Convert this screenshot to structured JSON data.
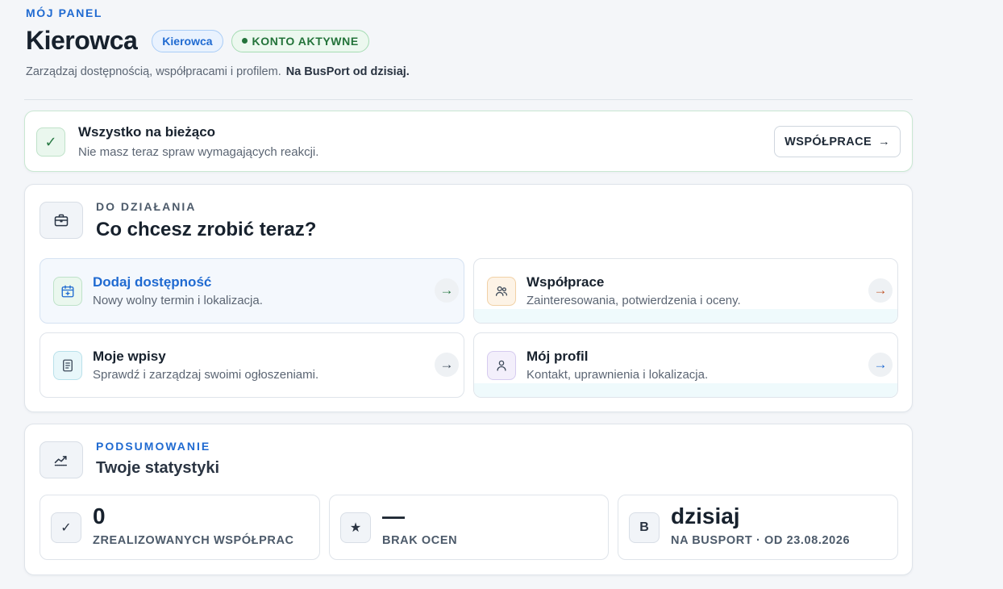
{
  "header": {
    "eyebrow": "MÓJ PANEL",
    "title": "Kierowca",
    "role_badge": "Kierowca",
    "status_badge": "KONTO AKTYWNE",
    "subtitle": "Zarządzaj dostępnością, współpracami i profilem.",
    "subtitle_strong": "Na BusPort od dzisiaj."
  },
  "notice": {
    "icon": "check-icon",
    "check_glyph": "✓",
    "title": "Wszystko na bieżąco",
    "text": "Nie masz teraz spraw wymagających reakcji.",
    "button_label": "WSPÓŁPRACE",
    "button_arrow": "→"
  },
  "actions": {
    "icon": "briefcase-icon",
    "eyebrow": "DO DZIAŁANIA",
    "title": "Co chcesz zrobić teraz?",
    "tiles": [
      {
        "title": "Dodaj dostępność",
        "desc": "Nowy wolny termin i lokalizacja.",
        "icon": "calendar-plus-icon",
        "arrow": "→",
        "accent": "#2a7a45"
      },
      {
        "title": "Współprace",
        "desc": "Zainteresowania, potwierdzenia i oceny.",
        "icon": "users-icon",
        "arrow": "→",
        "accent": "#c0562a"
      },
      {
        "title": "Moje wpisy",
        "desc": "Sprawdź i zarządzaj swoimi ogłoszeniami.",
        "icon": "document-icon",
        "arrow": "→",
        "accent": "#3d4a5a"
      },
      {
        "title": "Mój profil",
        "desc": "Kontakt, uprawnienia i lokalizacja.",
        "icon": "user-icon",
        "arrow": "→",
        "accent": "#1f6ad1"
      }
    ]
  },
  "stats": {
    "icon": "trend-chart-icon",
    "eyebrow": "PODSUMOWANIE",
    "title": "Twoje statystyki",
    "items": [
      {
        "icon": "check-icon",
        "glyph": "✓",
        "value": "0",
        "label": "ZREALIZOWANYCH WSPÓŁPRAC"
      },
      {
        "icon": "star-icon",
        "glyph": "★",
        "value": "—",
        "label": "BRAK OCEN"
      },
      {
        "icon": "initial-b-icon",
        "glyph": "B",
        "value": "dzisiaj",
        "label": "NA BUSPORT · OD 23.08.2026"
      }
    ]
  },
  "colors": {
    "accent": "#1f6ad1",
    "success": "#23733a",
    "background": "#f4f6f9"
  }
}
